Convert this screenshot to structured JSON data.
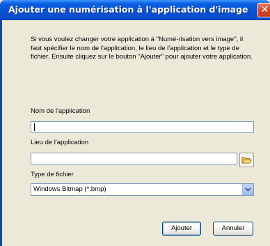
{
  "window": {
    "title": "Ajouter une numérisation à l'application d'image",
    "close_glyph": "✕"
  },
  "intro_text": "Si vous voulez changer votre application à \"Numé-risation vers image\", il faut spécifier le nom de l'application, le lieu de l'application et le type de fichier. Ensuite cliquez sur le bouton \"Ajouter\" pour ajouter votre application.",
  "fields": {
    "app_name_label": "Nom de l'application",
    "app_name_value": "",
    "app_location_label": "Lieu de l'application",
    "app_location_value": "",
    "file_type_label": "Type de fichier",
    "file_type_value": "Windows Bitmap (*.bmp)"
  },
  "buttons": {
    "add": "Ajouter",
    "cancel": "Annuler"
  },
  "icons": {
    "close": "close-icon",
    "folder": "folder-open-icon",
    "dropdown": "chevron-down-icon"
  },
  "colors": {
    "titlebar": "#0551d4",
    "dialog_bg": "#ece9d8",
    "field_border": "#7f9db9",
    "close_button": "#d9472a"
  }
}
